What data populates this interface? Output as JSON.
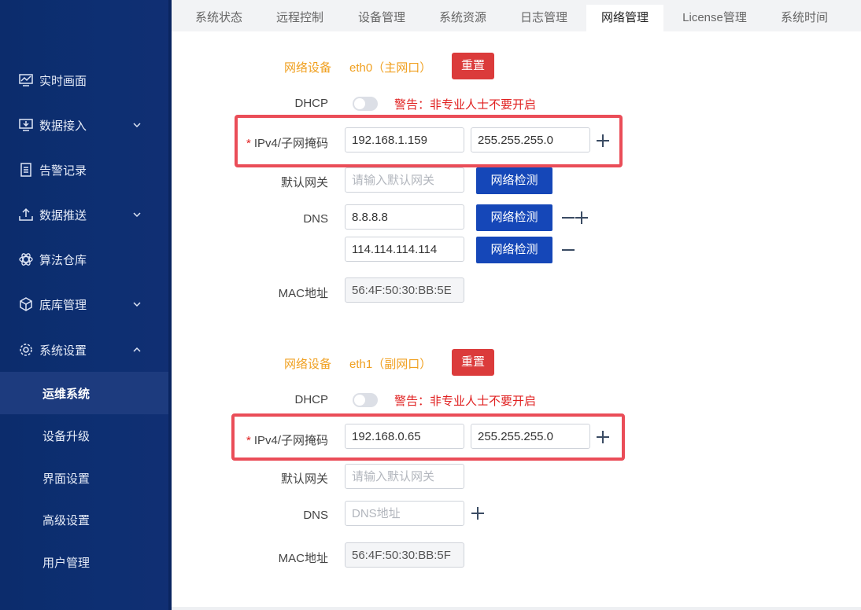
{
  "sidebar": {
    "items": [
      {
        "label": "实时画面",
        "icon": "monitor-chart-icon",
        "has_children": false
      },
      {
        "label": "数据接入",
        "icon": "data-input-icon",
        "has_children": true,
        "expanded": false
      },
      {
        "label": "告警记录",
        "icon": "document-list-icon",
        "has_children": false
      },
      {
        "label": "数据推送",
        "icon": "upload-tray-icon",
        "has_children": true,
        "expanded": false
      },
      {
        "label": "算法仓库",
        "icon": "algorithm-atom-icon",
        "has_children": false
      },
      {
        "label": "底库管理",
        "icon": "cube-icon",
        "has_children": true,
        "expanded": false
      },
      {
        "label": "系统设置",
        "icon": "gear-icon",
        "has_children": true,
        "expanded": true
      }
    ],
    "subitems": [
      "运维系统",
      "设备升级",
      "界面设置",
      "高级设置",
      "用户管理"
    ],
    "active_subitem": "运维系统"
  },
  "tabs": [
    "系统状态",
    "远程控制",
    "设备管理",
    "系统资源",
    "日志管理",
    "网络管理",
    "License管理",
    "系统时间"
  ],
  "active_tab": "网络管理",
  "interfaces": [
    {
      "device_label": "网络设备",
      "device_name": "eth0（主网口）",
      "reset_label": "重置",
      "dhcp_label": "DHCP",
      "dhcp_enabled": false,
      "warning": "警告：非专业人士不要开启",
      "ipv4_label": "IPv4/子网掩码",
      "ip": "192.168.1.159",
      "mask": "255.255.255.0",
      "gateway_label": "默认网关",
      "gateway_placeholder": "请输入默认网关",
      "check_label": "网络检测",
      "dns_label": "DNS",
      "dns": [
        "8.8.8.8",
        "114.114.114.114"
      ],
      "mac_label": "MAC地址",
      "mac": "56:4F:50:30:BB:5E"
    },
    {
      "device_label": "网络设备",
      "device_name": "eth1（副网口）",
      "reset_label": "重置",
      "dhcp_label": "DHCP",
      "dhcp_enabled": false,
      "warning": "警告：非专业人士不要开启",
      "ipv4_label": "IPv4/子网掩码",
      "ip": "192.168.0.65",
      "mask": "255.255.255.0",
      "gateway_label": "默认网关",
      "gateway_placeholder": "请输入默认网关",
      "dns_label": "DNS",
      "dns_placeholder": "DNS地址",
      "mac_label": "MAC地址",
      "mac": "56:4F:50:30:BB:5F"
    }
  ],
  "colors": {
    "sidebar": "#0d2f72",
    "primary": "#1547b8",
    "danger": "#db3b3b",
    "warning_text": "#e02020",
    "orange": "#f0a020",
    "highlight": "#ea4d58"
  }
}
